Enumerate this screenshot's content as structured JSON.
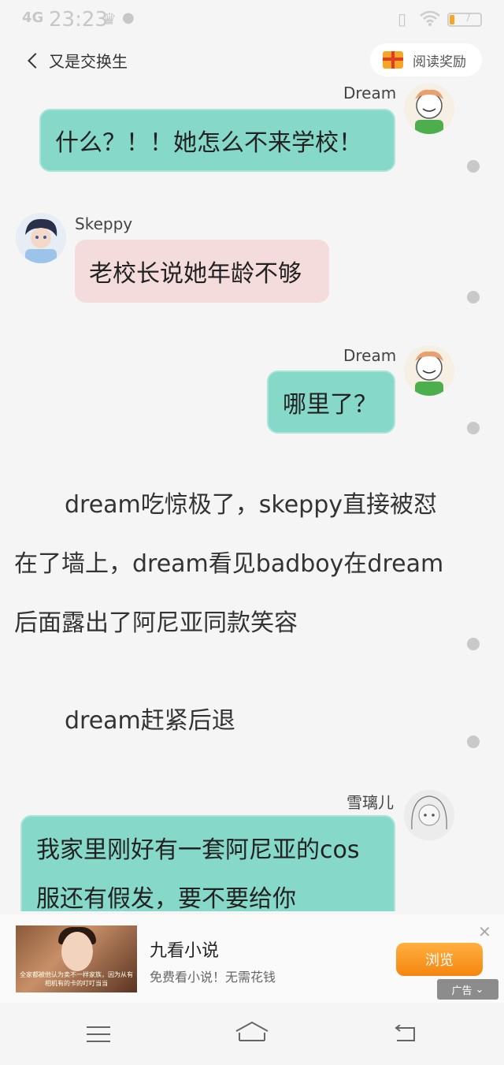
{
  "status_bar": {
    "signal": "4G",
    "time": "23:23",
    "battery_level": "7"
  },
  "header": {
    "back_title": "又是交换生",
    "reward_label": "阅读奖励"
  },
  "messages": [
    {
      "speaker": "Dream",
      "text": "什么？！！她怎么不来学校！"
    },
    {
      "speaker": "Skeppy",
      "text": "老校长说她年龄不够"
    },
    {
      "speaker": "Dream",
      "text": "哪里了？"
    },
    {
      "speaker": "雪璃儿",
      "text": "我家里刚好有一套阿尼亚的cos服还有假发，要不要给你"
    }
  ],
  "narration": [
    "dream吃惊极了，skeppy直接被怼在了墙上，dream看见badboy在dream后面露出了阿尼亚同款笑容",
    "dream赶紧后退"
  ],
  "ad": {
    "title": "九看小说",
    "description": "免费看小说！无需花钱",
    "button": "浏览",
    "tag": "广告",
    "image_caption": "全家都被他认为卖不一样家族，因为从有相机有的卡的叮叮当当"
  },
  "colors": {
    "teal_bubble": "#86d8c9",
    "pink_bubble": "#f5dcdc",
    "background": "#f5f5f5",
    "ad_button": "#f5860f"
  },
  "icons": [
    "back-chevron-icon",
    "gift-icon",
    "close-icon",
    "menu-icon",
    "home-icon",
    "back-icon",
    "wifi-icon",
    "battery-icon"
  ]
}
